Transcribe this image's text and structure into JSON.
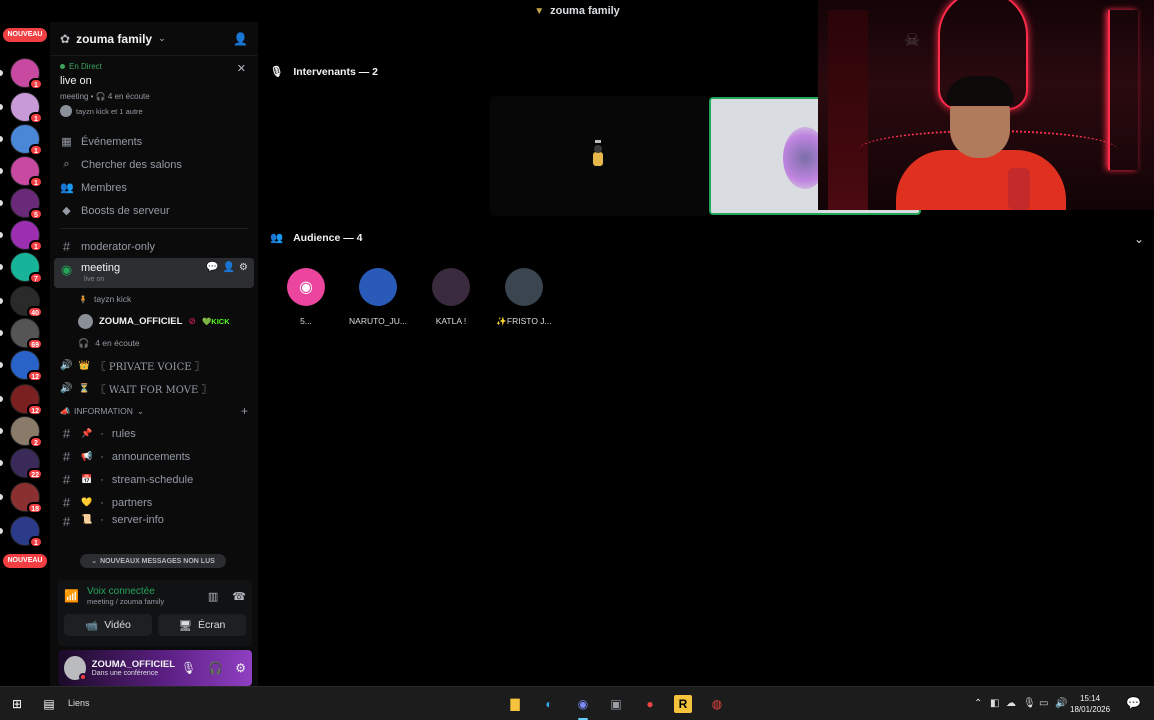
{
  "window": {
    "title": "zouma family"
  },
  "rail": {
    "top_label": "NOUVEAU",
    "bottom_label": "NOUVEAU",
    "servers": [
      {
        "badge": "1",
        "color": "#c74aa0"
      },
      {
        "badge": "1",
        "color": "#c99ad8"
      },
      {
        "badge": "1",
        "color": "#4a87d6"
      },
      {
        "badge": "1",
        "color": "#c74aa0"
      },
      {
        "badge": "5",
        "color": "#6a2a7a"
      },
      {
        "badge": "1",
        "color": "#9b2fb0"
      },
      {
        "badge": "7",
        "color": "#18b49a"
      },
      {
        "badge": "40",
        "color": "#2a2a2a"
      },
      {
        "badge": "69",
        "color": "#555555"
      },
      {
        "badge": "12",
        "color": "#2a63c7"
      },
      {
        "badge": "12",
        "color": "#7a2020"
      },
      {
        "badge": "2",
        "color": "#8a7a6a"
      },
      {
        "badge": "22",
        "color": "#3a2a5a"
      },
      {
        "badge": "18",
        "color": "#8a3030"
      },
      {
        "badge": "1",
        "color": "#2c3a8a"
      }
    ]
  },
  "sidebar": {
    "server_name": "zouma family",
    "live": {
      "status": "En Direct",
      "title": "live on",
      "meta": "meeting • 🎧 4 en écoute",
      "people": "tayzn kick et 1 autre"
    },
    "nav": [
      {
        "label": "Événements",
        "icon": "calendar-icon"
      },
      {
        "label": "Chercher des salons",
        "icon": "search-channels-icon"
      },
      {
        "label": "Membres",
        "icon": "members-icon"
      },
      {
        "label": "Boosts de serveur",
        "icon": "boost-icon"
      }
    ],
    "channels": {
      "moderator": "moderator-only",
      "meeting": {
        "label": "meeting",
        "sub": "live on"
      },
      "members": [
        {
          "name": "tayzn kick"
        },
        {
          "name": "ZOUMA_OFFICIEL",
          "tag": "KICK"
        }
      ],
      "listening": "4 en écoute",
      "private_voice": "〖 PRIVATE VOICE 〗",
      "wait_for_move": "〖 WAIT FOR MOVE 〗"
    },
    "category": {
      "label": "INFORMATION"
    },
    "info_channels": [
      {
        "emoji": "📌",
        "label": "rules"
      },
      {
        "emoji": "📢",
        "label": "announcements"
      },
      {
        "emoji": "📅",
        "label": "stream-schedule"
      },
      {
        "emoji": "💛",
        "label": "partners"
      },
      {
        "emoji": "📜",
        "label": "server-info"
      }
    ],
    "new_messages": "NOUVEAUX MESSAGES NON LUS"
  },
  "voice_panel": {
    "status": "Voix connectée",
    "location": "meeting / zouma family",
    "video_label": "Vidéo",
    "screen_label": "Écran"
  },
  "user_panel": {
    "name": "ZOUMA_OFFICIEL",
    "status": "Dans une conférence"
  },
  "main": {
    "speakers_header": "Intervenants — 2",
    "audience_header": "Audience — 4",
    "audience": [
      {
        "name": "5...",
        "color": "#eb459e"
      },
      {
        "name": "NARUTO_JU...",
        "color": "#2a5ab8"
      },
      {
        "name": "KATLA !",
        "color": "#3a2a3e"
      },
      {
        "name": "✨FRISTO J...",
        "color": "#3a4550"
      }
    ]
  },
  "taskbar": {
    "label": "Liens",
    "time": "15:14",
    "date": "18/01/2026"
  }
}
